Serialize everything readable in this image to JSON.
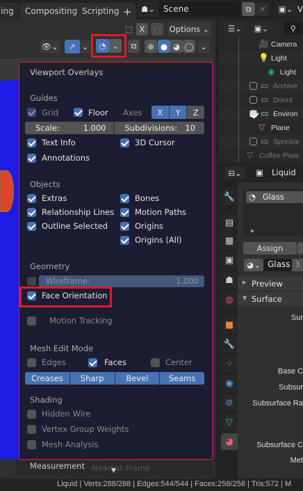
{
  "topbar": {
    "tabs": [
      "ing",
      "Compositing",
      "Scripting"
    ],
    "add_tab": "+",
    "scene": "Scene",
    "view_layer_partial": "V"
  },
  "viewport": {
    "options": "Options",
    "xray_x": "X",
    "footer_measurement": "Measurement",
    "footer_nearest_frame": "Nearest Frame"
  },
  "overlays": {
    "title": "Viewport Overlays",
    "sections": {
      "guides": "Guides",
      "objects": "Objects",
      "geometry": "Geometry",
      "mesh_edit": "Mesh Edit Mode",
      "shading": "Shading"
    },
    "grid": {
      "label": "Grid",
      "checked": true
    },
    "floor": {
      "label": "Floor",
      "checked": true
    },
    "axes": {
      "label": "Axes",
      "x": "X",
      "y": "Y",
      "z": "Z",
      "x_on": true,
      "y_on": true,
      "z_on": false
    },
    "scale": {
      "label": "Scale:",
      "value": "1.000"
    },
    "subdivisions": {
      "label": "Subdivisions:",
      "value": "10"
    },
    "checkboxes": [
      {
        "label": "Text Info",
        "checked": true
      },
      {
        "label": "3D Cursor",
        "checked": true
      },
      {
        "label": "Annotations",
        "checked": true
      },
      {
        "label": "Extras",
        "checked": true
      },
      {
        "label": "Bones",
        "checked": true
      },
      {
        "label": "Relationship Lines",
        "checked": true
      },
      {
        "label": "Motion Paths",
        "checked": true
      },
      {
        "label": "Outline Selected",
        "checked": true
      },
      {
        "label": "Origins",
        "checked": true
      },
      {
        "label": "Origins (All)",
        "checked": true
      },
      {
        "label": "Face Orientation",
        "checked": true
      },
      {
        "label": "Motion Tracking",
        "checked": false
      },
      {
        "label": "Edges",
        "checked": false
      },
      {
        "label": "Faces",
        "checked": true
      },
      {
        "label": "Center",
        "checked": false
      },
      {
        "label": "Hidden Wire",
        "checked": false
      },
      {
        "label": "Vertex Group Weights",
        "checked": false
      },
      {
        "label": "Mesh Analysis",
        "checked": false
      }
    ],
    "wireframe": {
      "label": "Wireframe:",
      "value": "1.000",
      "checked": false
    },
    "mesh_buttons": [
      "Creases",
      "Sharp",
      "Bevel",
      "Seams"
    ]
  },
  "outliner": {
    "items": [
      "Camera",
      "Light",
      "Light",
      "Archive",
      "Donut",
      "Environ",
      "Plane",
      "Sprinkle",
      "Coffee Plate"
    ]
  },
  "properties": {
    "object": "Liquid",
    "slot": "Glass",
    "assign": "Assign",
    "material": "Glass",
    "users": "3",
    "preview": "Preview",
    "surface": "Surface",
    "labels": [
      "Sur",
      "Base C",
      "Subsur",
      "Subsurface Ra",
      "Subsurface C",
      "Met"
    ]
  },
  "status": {
    "text": "Liquid | Verts:288/288 | Edges:544/544 | Faces:258/258 | Tris:572 | M"
  },
  "colors": {
    "accent": "#4772b3",
    "highlight": "#e21c26",
    "viewport_bg": "#1c1ce6"
  }
}
